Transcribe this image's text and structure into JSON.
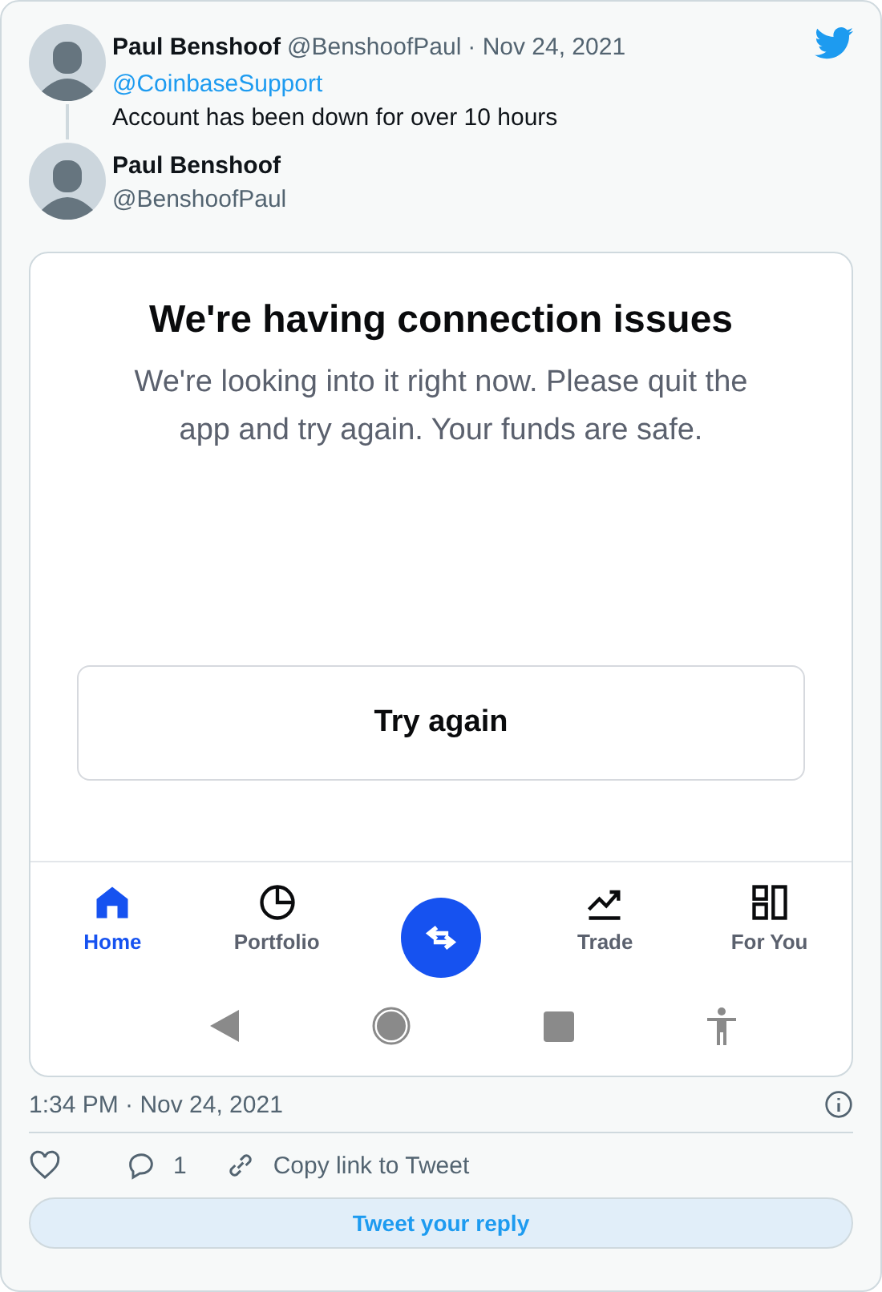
{
  "tweet": {
    "author": {
      "name": "Paul Benshoof",
      "handle": "@BenshoofPaul",
      "date": "· Nov 24, 2021"
    },
    "mention": "@CoinbaseSupport",
    "text": "Account has been down for over 10 hours"
  },
  "reply_author": {
    "name": "Paul Benshoof",
    "handle": "@BenshoofPaul"
  },
  "app_screenshot": {
    "title": "We're having connection issues",
    "message": "We're looking into it right now. Please quit the app and try again. Your funds are safe.",
    "button": "Try again",
    "nav": [
      {
        "kind": "tab",
        "label": "Home",
        "selected": true
      },
      {
        "kind": "tab",
        "label": "Portfolio",
        "selected": false
      },
      {
        "kind": "action",
        "selected": false
      },
      {
        "kind": "tab",
        "label": "Trade",
        "selected": false
      },
      {
        "kind": "tab",
        "label": "For You",
        "selected": false
      }
    ]
  },
  "timestamp": "1:34 PM · Nov 24, 2021",
  "actions": {
    "reply_count": "1",
    "copy_link": "Copy link to Tweet"
  },
  "reply_button": "Tweet your reply"
}
